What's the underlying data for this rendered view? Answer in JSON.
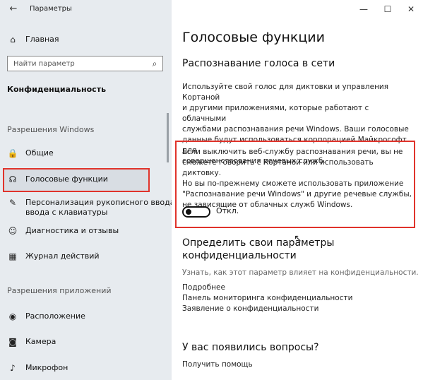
{
  "titlebar": {
    "back_glyph": "←",
    "title": "Параметры",
    "min_glyph": "—",
    "max_glyph": "☐",
    "close_glyph": "✕"
  },
  "sidebar": {
    "home_label": "Главная",
    "search_placeholder": "Найти параметр",
    "section_title": "Конфиденциальность",
    "group_windows": "Разрешения Windows",
    "group_apps": "Разрешения приложений",
    "items_windows": [
      {
        "label": "Общие",
        "icon": "lock-icon",
        "glyph": "🔒"
      },
      {
        "label": "Голосовые функции",
        "icon": "voice-icon",
        "glyph": "☊",
        "selected": true
      },
      {
        "label": "Персонализация рукописного ввода и",
        "label2": "ввода с клавиатуры",
        "icon": "handwriting-icon",
        "glyph": "✎"
      },
      {
        "label": "Диагностика и отзывы",
        "icon": "feedback-icon",
        "glyph": "☺"
      },
      {
        "label": "Журнал действий",
        "icon": "history-icon",
        "glyph": "▦"
      }
    ],
    "items_apps": [
      {
        "label": "Расположение",
        "icon": "location-icon",
        "glyph": "◉"
      },
      {
        "label": "Камера",
        "icon": "camera-icon",
        "glyph": "◙"
      },
      {
        "label": "Микрофон",
        "icon": "microphone-icon",
        "glyph": "♪"
      }
    ]
  },
  "main": {
    "page_title": "Голосовые функции",
    "section1_title": "Распознавание голоса в сети",
    "section1_desc": [
      "Используйте свой голос для диктовки и управления Кортаной",
      "и другими приложениями, которые работают с облачными",
      "службами распознавания речи Windows. Ваши голосовые",
      "данные будут использоваться корпорацией Майкрософт для",
      "совершенствования речевых служб."
    ],
    "warning_text": [
      "Если выключить веб-службу распознавания речи, вы не",
      "сможете говорить с Кортаной или использовать диктовку.",
      "Но вы по-прежнему сможете использовать приложение",
      "\"Распознавание речи Windows\" и другие речевые службы,",
      "не зависящие от облачных служб Windows."
    ],
    "toggle_state": "Откл.",
    "section2_title_1": "Определить свои параметры",
    "section2_title_2": "конфиденциальности",
    "section2_subtitle": "Узнать, как этот параметр влияет на конфиденциальности.",
    "links": [
      "Подробнее",
      "Панель мониторинга конфиденциальности",
      "Заявление о конфиденциальности"
    ],
    "section3_title": "У вас появились вопросы?",
    "help_link": "Получить помощь"
  }
}
